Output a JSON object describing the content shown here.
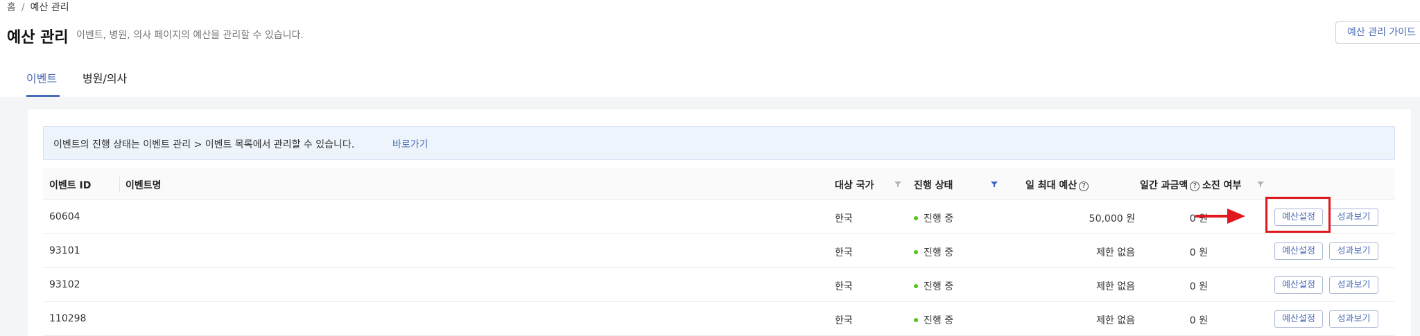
{
  "breadcrumb": {
    "home": "홈",
    "separator": "/",
    "current": "예산 관리"
  },
  "page": {
    "title": "예산 관리",
    "description": "이벤트, 병원, 의사 페이지의 예산을 관리할 수 있습니다.",
    "guide_button": "예산 관리 가이드"
  },
  "tabs": [
    {
      "label": "이벤트",
      "active": true
    },
    {
      "label": "병원/의사",
      "active": false
    }
  ],
  "notice": {
    "text": "이벤트의 진행 상태는 이벤트 관리 > 이벤트 목록에서 관리할 수 있습니다.",
    "link": "바로가기"
  },
  "table": {
    "columns": {
      "event_id": "이벤트 ID",
      "event_name": "이벤트명",
      "country": "대상 국가",
      "status": "진행 상태",
      "daily_max_budget": "일 최대 예산",
      "daily_charge": "일간 과금액",
      "exhausted": "소진 여부"
    },
    "help_icon": "?",
    "rows": [
      {
        "id": "60604",
        "name": "",
        "country": "한국",
        "status": "진행 중",
        "budget": "50,000 원",
        "charge": "0 원",
        "exhausted": "",
        "btn_budget": "예산설정",
        "btn_perf": "성과보기"
      },
      {
        "id": "93101",
        "name": "",
        "country": "한국",
        "status": "진행 중",
        "budget": "제한 없음",
        "charge": "0 원",
        "exhausted": "",
        "btn_budget": "예산설정",
        "btn_perf": "성과보기"
      },
      {
        "id": "93102",
        "name": "",
        "country": "한국",
        "status": "진행 중",
        "budget": "제한 없음",
        "charge": "0 원",
        "exhausted": "",
        "btn_budget": "예산설정",
        "btn_perf": "성과보기"
      },
      {
        "id": "110298",
        "name": "",
        "country": "한국",
        "status": "진행 중",
        "budget": "제한 없음",
        "charge": "0 원",
        "exhausted": "",
        "btn_budget": "예산설정",
        "btn_perf": "성과보기"
      }
    ]
  },
  "colors": {
    "accent": "#4a6bb5",
    "status_active": "#52c41a",
    "annotation_red": "#e0171c",
    "filter_active": "#3b63c9",
    "filter_inactive": "#b4b4b4"
  },
  "icons": {
    "filter": "filter-icon",
    "help": "help-circle-icon",
    "annotation": "red-arrow-icon"
  }
}
